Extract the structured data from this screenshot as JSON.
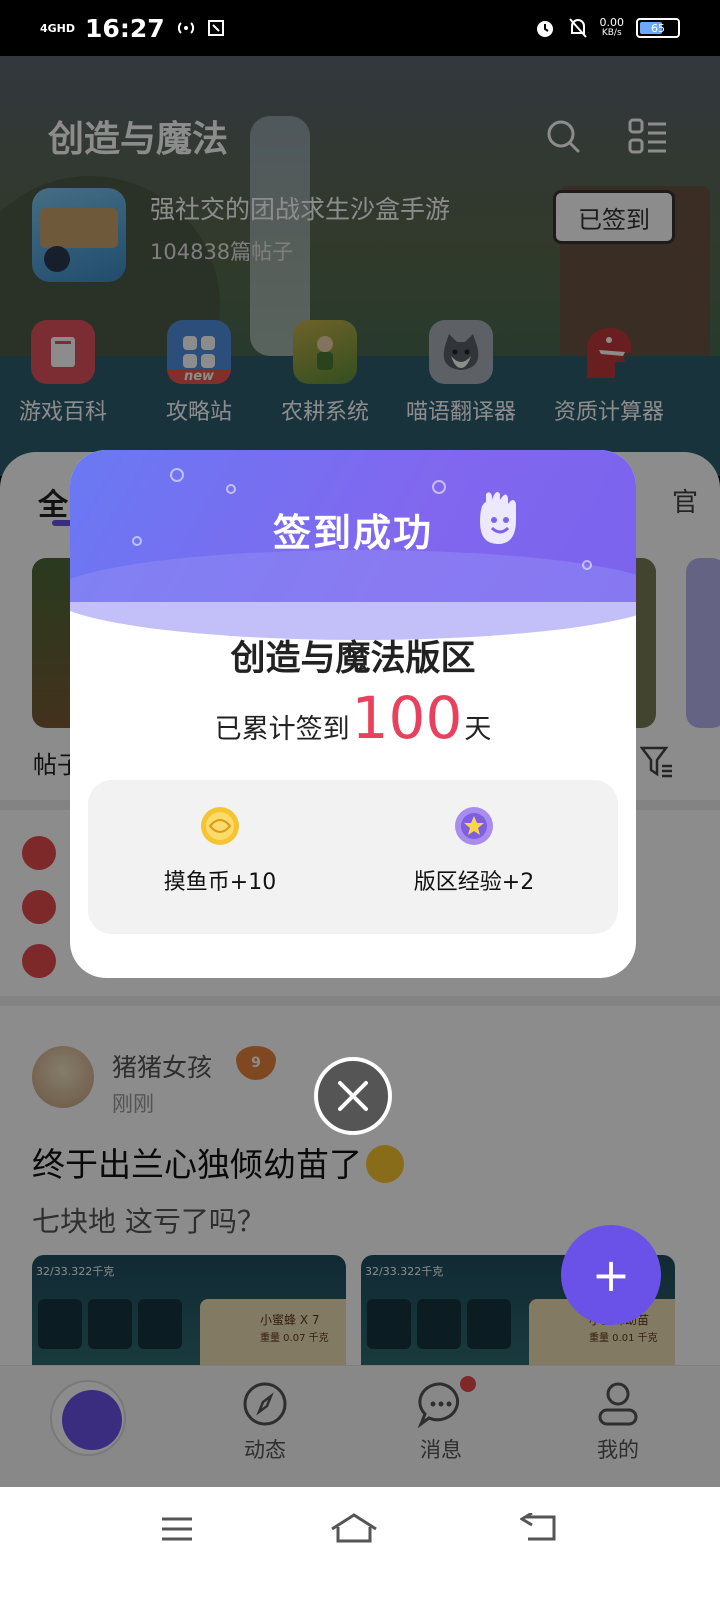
{
  "status_bar": {
    "network": "4GHD",
    "time": "16:27",
    "speed_value": "0.00",
    "speed_unit": "KB/s",
    "battery": "65",
    "battery_level": 0.65
  },
  "header": {
    "title": "创造与魔法",
    "description": "强社交的团战求生沙盒手游",
    "post_count": "104838篇帖子",
    "checkin_button": "已签到"
  },
  "quick_links": [
    {
      "label": "游戏百科",
      "icon": "encyclopedia-icon",
      "color": "#e2525e"
    },
    {
      "label": "攻略站",
      "icon": "strategy-grid-icon",
      "color": "#e9574d",
      "badge": "new"
    },
    {
      "label": "农耕系统",
      "icon": "farming-icon",
      "color": "#7a8f3a"
    },
    {
      "label": "喵语翻译器",
      "icon": "cat-translator-icon",
      "color": "#8a8f97"
    },
    {
      "label": "资质计算器",
      "icon": "dinosaur-calculator-icon",
      "color": "#c0393b"
    }
  ],
  "feed": {
    "tab_active": "全",
    "tab_right_partial": "官",
    "card_left_caption": "帖子"
  },
  "post": {
    "author": "猪猪女孩",
    "level_badge": "9",
    "time": "刚刚",
    "title": "终于出兰心独倾幼苗了",
    "body": "七块地 这亏了吗？",
    "image_caption_left": "32/33.322千克",
    "image_caption_right": "32/33.322千克",
    "image_item_left": "小蜜蜂 X 7",
    "image_item_left_sub": "重量 0.07 千克",
    "image_item_right": "小蜜蜂幼苗",
    "image_item_right_sub": "重量 0.01 千克"
  },
  "fab": {
    "label": "+"
  },
  "bottom_nav": [
    {
      "label": "",
      "icon": "home-fish-icon"
    },
    {
      "label": "动态",
      "icon": "compass-icon"
    },
    {
      "label": "消息",
      "icon": "chat-bubble-icon"
    },
    {
      "label": "我的",
      "icon": "profile-icon"
    }
  ],
  "modal": {
    "title": "签到成功",
    "forum_name": "创造与魔法版区",
    "streak_prefix": "已累计签到",
    "streak_days": "100",
    "streak_suffix": "天",
    "rewards": [
      {
        "label": "摸鱼币+10",
        "icon": "fish-coin-icon"
      },
      {
        "label": "版区经验+2",
        "icon": "experience-star-icon"
      }
    ],
    "close_icon": "close-icon"
  },
  "colors": {
    "accent": "#6a52e8",
    "streak_number": "#e8405d",
    "modal_gradient_start": "#6a79f3",
    "modal_gradient_end": "#7b63ed"
  }
}
